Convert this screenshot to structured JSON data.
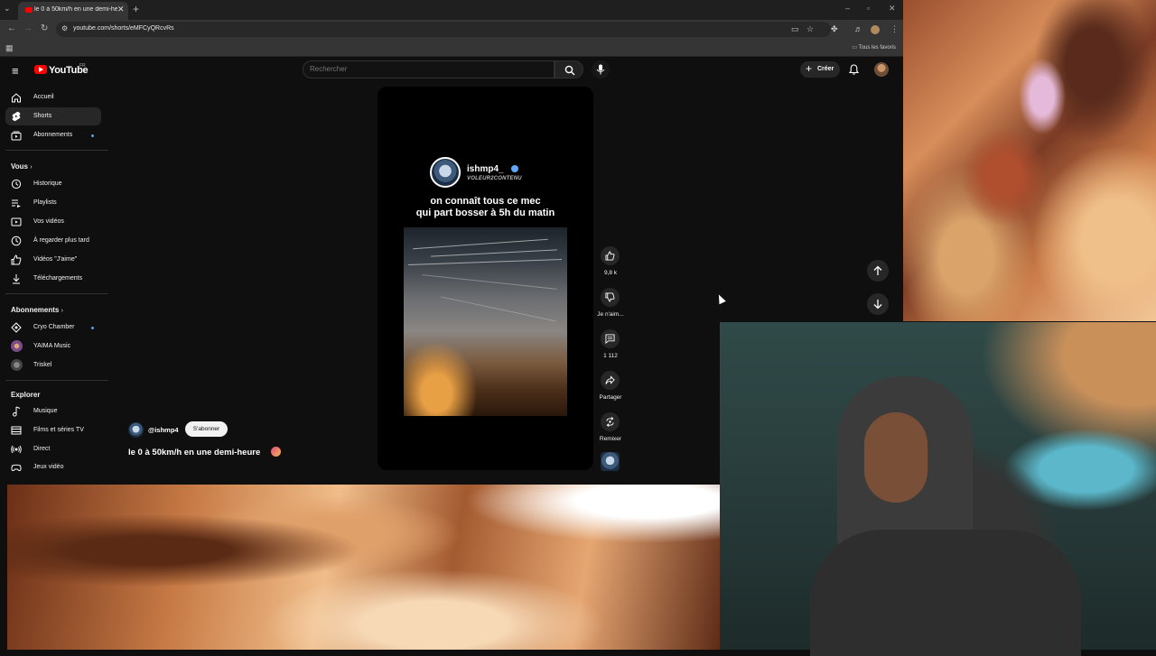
{
  "browser": {
    "tab_title": "le 0 à 50km/h en une demi-heure",
    "url": "youtube.com/shorts/eMFCyQRcvRs",
    "bookmarks_all": "Tous les favoris"
  },
  "masthead": {
    "logo_text": "YouTube",
    "country": "FR",
    "search_placeholder": "Rechercher",
    "create_label": "Créer"
  },
  "sidebar": {
    "main": [
      {
        "label": "Accueil",
        "icon": "home-icon"
      },
      {
        "label": "Shorts",
        "icon": "shorts-icon"
      },
      {
        "label": "Abonnements",
        "icon": "subscriptions-icon"
      }
    ],
    "you_heading": "Vous",
    "you": [
      {
        "label": "Historique",
        "icon": "history-icon"
      },
      {
        "label": "Playlists",
        "icon": "playlists-icon"
      },
      {
        "label": "Vos vidéos",
        "icon": "your-videos-icon"
      },
      {
        "label": "À regarder plus tard",
        "icon": "watch-later-icon"
      },
      {
        "label": "Vidéos \"J'aime\"",
        "icon": "liked-icon"
      },
      {
        "label": "Téléchargements",
        "icon": "download-icon"
      }
    ],
    "subs_heading": "Abonnements",
    "subs": [
      {
        "label": "Cryo Chamber"
      },
      {
        "label": "YAIMA Music"
      },
      {
        "label": "Triskel"
      }
    ],
    "explore_heading": "Explorer",
    "explore": [
      {
        "label": "Musique",
        "icon": "music-icon"
      },
      {
        "label": "Films et séries TV",
        "icon": "movies-icon"
      },
      {
        "label": "Direct",
        "icon": "live-icon"
      },
      {
        "label": "Jeux vidéo",
        "icon": "gaming-icon"
      }
    ]
  },
  "short": {
    "overlay_handle": "ishmp4_",
    "overlay_sub": "VOLEUR2CONTENU",
    "caption_line1": "on connaît tous ce mec",
    "caption_line2": "qui part bosser à 5h du matin",
    "channel_handle": "@ishmp4",
    "subscribe_label": "S'abonner",
    "title": "le 0 à 50km/h en une demi-heure",
    "likes": "9,8 k",
    "dislike_label": "Je n'aim...",
    "comments": "1 112",
    "share_label": "Partager",
    "remix_label": "Remixer"
  },
  "colors": {
    "accent_red": "#ff0000",
    "background": "#0f0f0f",
    "chip": "#272727",
    "new_dot": "#3ea6ff"
  }
}
